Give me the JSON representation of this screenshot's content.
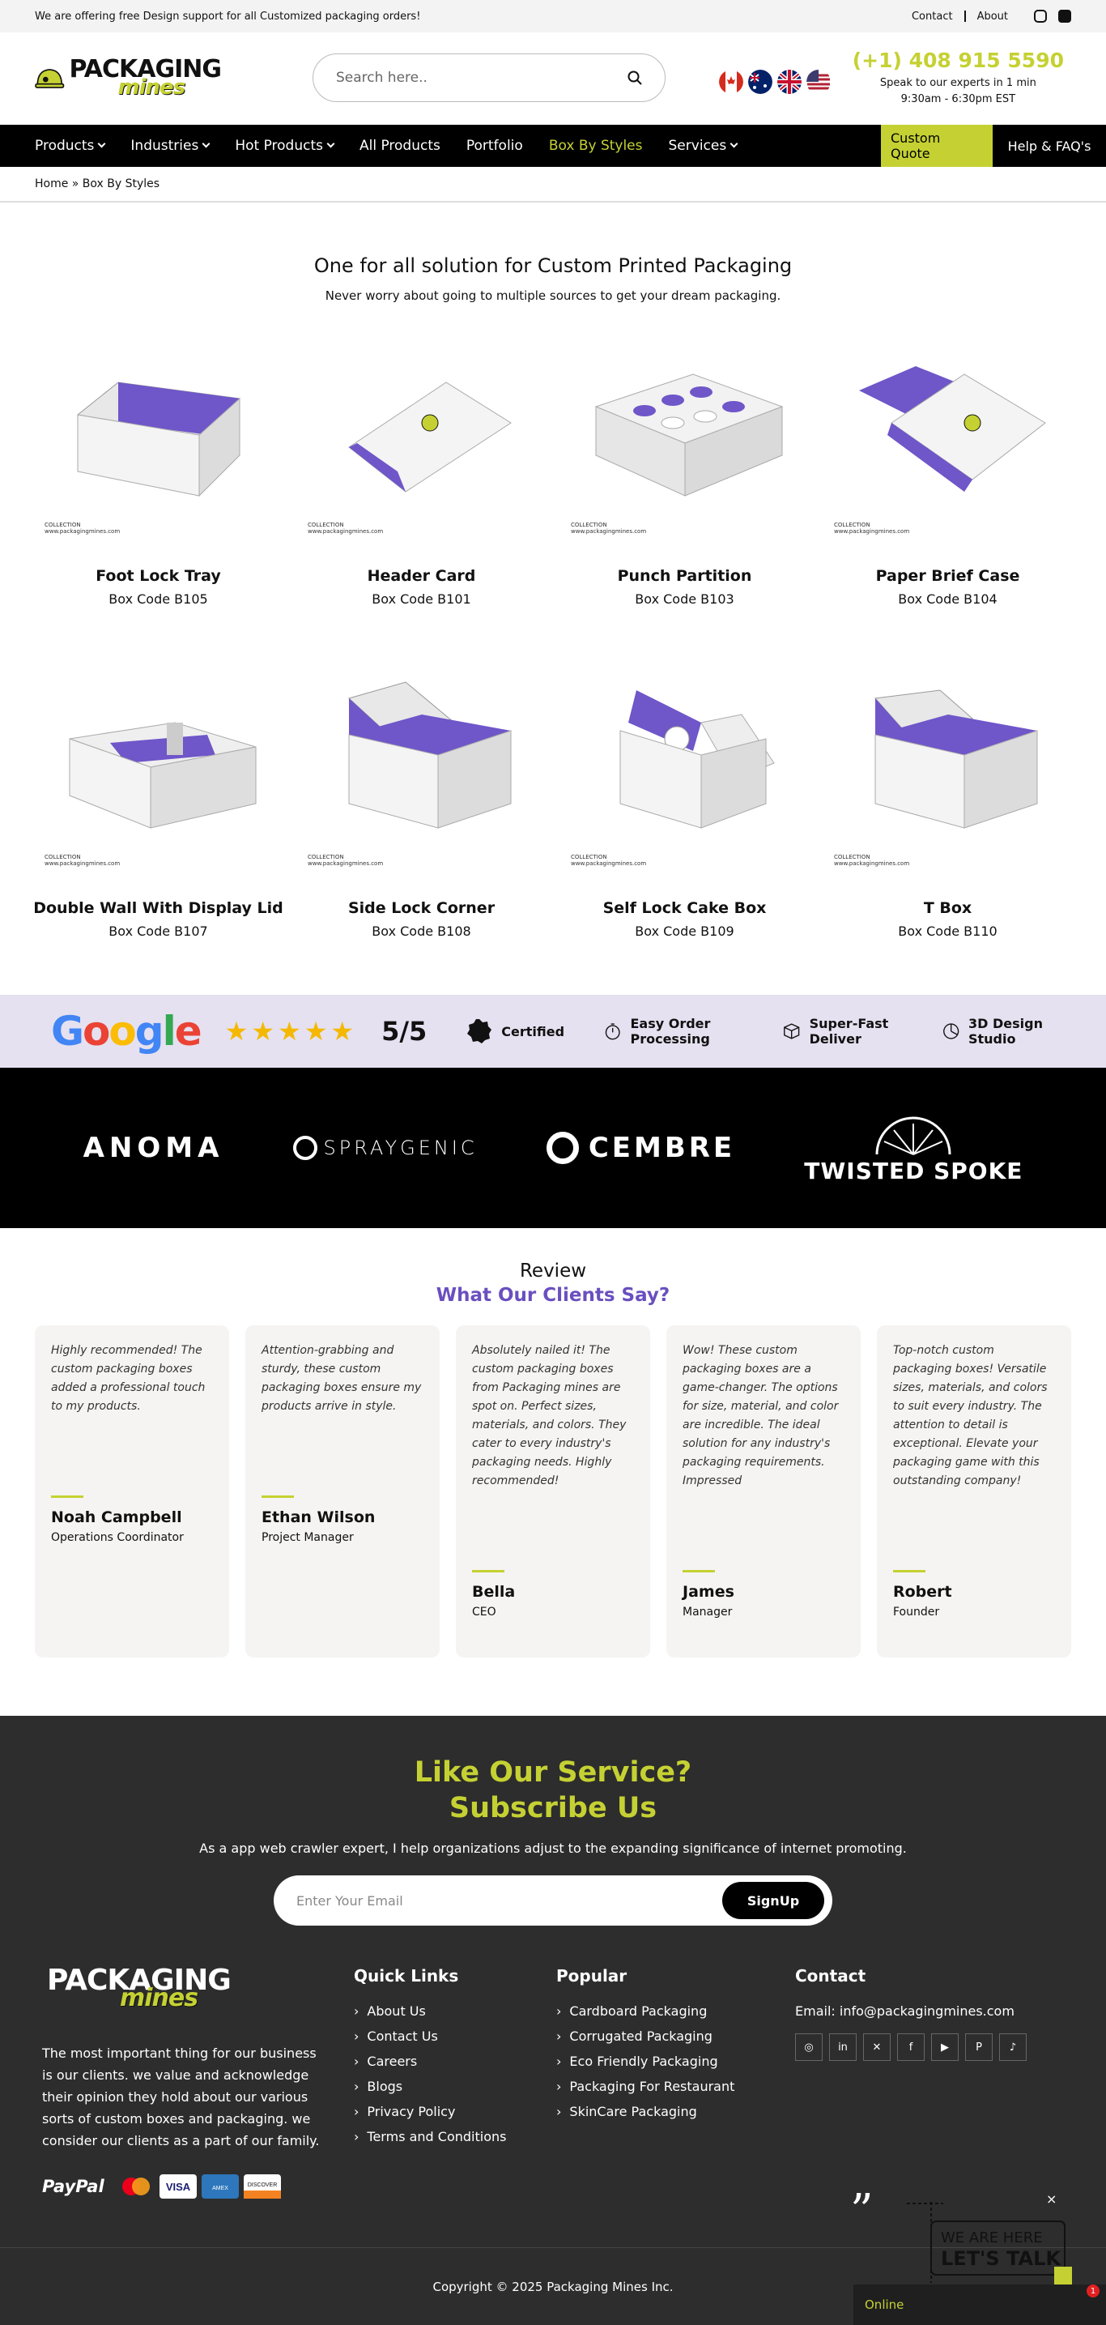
{
  "topbar": {
    "promo": "We are offering free Design support for all Customized packaging orders!",
    "links": [
      "Contact",
      "About"
    ]
  },
  "header": {
    "logo_line1": "PACKAGING",
    "logo_line2": "mines",
    "search_placeholder": "Search here..",
    "phone": "(+1) 408 915 5590",
    "phone_sub1": "Speak to our experts in 1 min",
    "phone_sub2": "9:30am - 6:30pm EST"
  },
  "nav": {
    "items": [
      "Products",
      "Industries",
      "Hot Products",
      "All Products",
      "Portfolio",
      "Box By Styles",
      "Services"
    ],
    "quote": "Custom Quote",
    "help": "Help & FAQ's"
  },
  "breadcrumb": "Home » Box By Styles",
  "intro": {
    "title": "One for all solution for Custom Printed Packaging",
    "subtitle": "Never worry about going to multiple sources to get your dream packaging."
  },
  "products": [
    {
      "name": "Foot Lock Tray",
      "code": "Box Code B105"
    },
    {
      "name": "Header Card",
      "code": "Box Code B101"
    },
    {
      "name": "Punch Partition",
      "code": "Box Code B103"
    },
    {
      "name": "Paper Brief Case",
      "code": "Box Code B104"
    },
    {
      "name": "Double Wall With Display Lid",
      "code": "Box Code B107"
    },
    {
      "name": "Side Lock Corner",
      "code": "Box Code B108"
    },
    {
      "name": "Self Lock Cake Box",
      "code": "Box Code B109"
    },
    {
      "name": "T Box",
      "code": "Box Code B110"
    }
  ],
  "watermark": {
    "line1": "COLLECTION",
    "line2": "www.packagingmines.com"
  },
  "trust": {
    "google": "Google",
    "rating": "5/5",
    "features": [
      "Certified",
      "Easy Order Processing",
      "Super-Fast Deliver",
      "3D Design Studio"
    ]
  },
  "brands": [
    "ANOMA",
    "SPRAYGENIC",
    "CEMBRE",
    "TWISTED SPOKE"
  ],
  "reviews": {
    "title": "Review",
    "subtitle": "What Our Clients Say?",
    "items": [
      {
        "text": "Highly recommended! The custom packaging boxes added a professional touch to my products.",
        "name": "Noah Campbell",
        "role": "Operations Coordinator"
      },
      {
        "text": "Attention-grabbing and sturdy, these custom packaging boxes ensure my products arrive in style.",
        "name": "Ethan Wilson",
        "role": "Project Manager"
      },
      {
        "text": "Absolutely nailed it! The custom packaging boxes from Packaging mines are spot on. Perfect sizes, materials, and colors. They cater to every industry's packaging needs. Highly recommended!",
        "name": "Bella",
        "role": "CEO"
      },
      {
        "text": "Wow! These custom packaging boxes are a game-changer. The options for size, material, and color are incredible. The ideal solution for any industry's packaging requirements. Impressed",
        "name": "James",
        "role": "Manager"
      },
      {
        "text": "Top-notch custom packaging boxes! Versatile sizes, materials, and colors to suit every industry. The attention to detail is exceptional. Elevate your packaging game with this outstanding company!",
        "name": "Robert",
        "role": "Founder"
      }
    ]
  },
  "subscribe": {
    "line1": "Like Our Service?",
    "line2": "Subscribe Us",
    "text": "As a app web crawler expert, I help organizations adjust to the expanding significance of internet promoting.",
    "placeholder": "Enter Your Email",
    "button": "SignUp"
  },
  "footer": {
    "about": "The most important thing for our business is our clients. we value and acknowledge their opinion they hold about our various sorts of custom boxes and packaging. we consider our clients as a part of our family.",
    "paypal": "PayPal",
    "quick_title": "Quick Links",
    "quick": [
      "About Us",
      "Contact Us",
      "Careers",
      "Blogs",
      "Privacy Policy",
      "Terms and Conditions"
    ],
    "popular_title": "Popular",
    "popular": [
      "Cardboard Packaging",
      "Corrugated Packaging",
      "Eco Friendly Packaging",
      "Packaging For Restaurant",
      "SkinCare Packaging"
    ],
    "contact_title": "Contact",
    "email": "Email: info@packagingmines.com",
    "copyright": "Copyright © 2025 Packaging Mines Inc."
  },
  "chat": {
    "status": "Online",
    "badge": "1",
    "talk1": "WE ARE HERE",
    "talk2": "LET'S TALK"
  },
  "colors": {
    "accent": "#c5d132",
    "purple": "#6a4fbf",
    "dark": "#2d2d2d"
  }
}
